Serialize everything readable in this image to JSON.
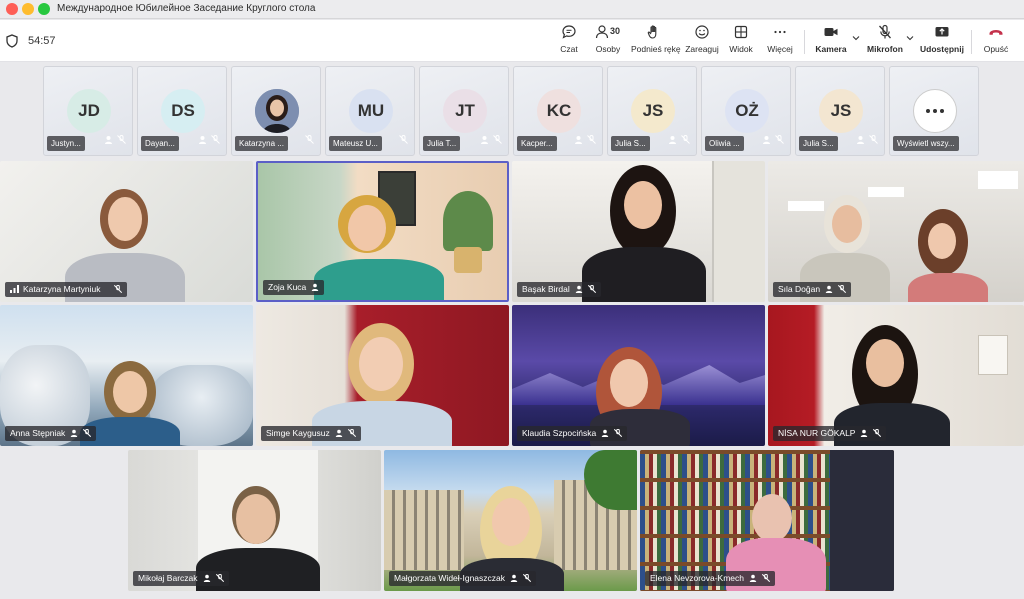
{
  "window": {
    "title": "Международное Юбилейное Заседание Круглого стола"
  },
  "toolbar": {
    "timer": "54:57",
    "chat_label": "Czat",
    "people_label": "Osoby",
    "people_count": "30",
    "raise_label": "Podnieś rękę",
    "react_label": "Zareaguj",
    "view_label": "Widok",
    "more_label": "Więcej",
    "camera_label": "Kamera",
    "mic_label": "Mikrofon",
    "share_label": "Udostępnij",
    "leave_label": "Opuść"
  },
  "strip": [
    {
      "initials": "JD",
      "name": "Justyn...",
      "color": "#d7ece6"
    },
    {
      "initials": "DS",
      "name": "Dayan...",
      "color": "#d6eef2"
    },
    {
      "initials": "",
      "name": "Katarzyna ...",
      "color": "#6b7fa0"
    },
    {
      "initials": "MU",
      "name": "Mateusz U...",
      "color": "#d9e1f1"
    },
    {
      "initials": "JT",
      "name": "Julia T...",
      "color": "#eadfe7"
    },
    {
      "initials": "KC",
      "name": "Kacper...",
      "color": "#efe0df"
    },
    {
      "initials": "JS",
      "name": "Julia S...",
      "color": "#f4e9cd"
    },
    {
      "initials": "OŻ",
      "name": "Oliwia ...",
      "color": "#dde3f3"
    },
    {
      "initials": "JS",
      "name": "Julia S...",
      "color": "#f3e6d1"
    },
    {
      "initials": "",
      "name": "Wyświetl wszy...",
      "color": "#ffffff"
    }
  ],
  "participants": [
    {
      "name": "Katarzyna Martyniuk"
    },
    {
      "name": "Zoja Kuca"
    },
    {
      "name": "Başak Birdal"
    },
    {
      "name": "Sıla Doğan"
    },
    {
      "name": "Anna Stępniak"
    },
    {
      "name": "Simge Kaygusuz"
    },
    {
      "name": "Klaudia Szpocińska"
    },
    {
      "name": "NİSA NUR GÖKALP"
    },
    {
      "name": "Mikołaj Barczak"
    },
    {
      "name": "Małgorzata Wideł-Ignaszczak"
    },
    {
      "name": "Elena Nevzorova-Kmech"
    }
  ],
  "colors": {
    "accent": "#5b5fc7",
    "leave": "#c4314b"
  }
}
